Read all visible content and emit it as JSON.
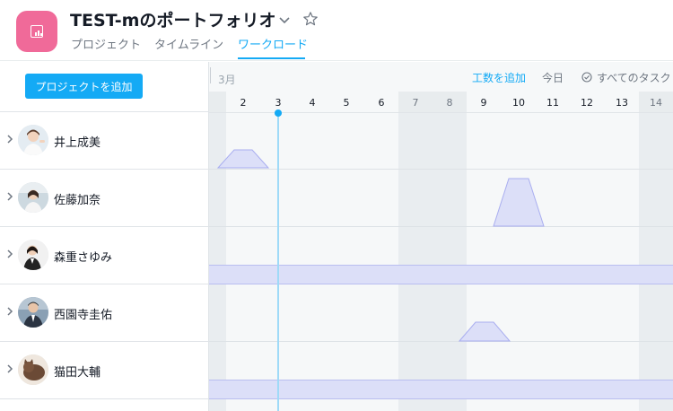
{
  "header": {
    "title": "TEST-mのポートフォリオ",
    "tabs": [
      {
        "label": "プロジェクト",
        "active": false
      },
      {
        "label": "タイムライン",
        "active": false
      },
      {
        "label": "ワークロード",
        "active": true
      }
    ],
    "app_icon": "chart-board-icon",
    "accent_color": "#14aaf5",
    "brand_color": "#f06a99"
  },
  "left": {
    "add_project_label": "プロジェクトを追加",
    "people": [
      {
        "name": "井上成美",
        "avatar": "avatar-woman-pointing"
      },
      {
        "name": "佐藤加奈",
        "avatar": "avatar-woman-office"
      },
      {
        "name": "森重さゆみ",
        "avatar": "avatar-woman-suit"
      },
      {
        "name": "西園寺圭佑",
        "avatar": "avatar-man-suit"
      },
      {
        "name": "猫田大輔",
        "avatar": "avatar-cat"
      }
    ]
  },
  "grid": {
    "month": "3月",
    "toolbar": {
      "add_effort": "工数を追加",
      "today": "今日",
      "all_tasks": "すべてのタスク"
    },
    "days": [
      {
        "label": "",
        "weekend": true
      },
      {
        "label": "2",
        "weekend": false
      },
      {
        "label": "3",
        "weekend": false
      },
      {
        "label": "4",
        "weekend": false
      },
      {
        "label": "5",
        "weekend": false
      },
      {
        "label": "6",
        "weekend": false
      },
      {
        "label": "7",
        "weekend": true
      },
      {
        "label": "8",
        "weekend": true
      },
      {
        "label": "9",
        "weekend": false
      },
      {
        "label": "10",
        "weekend": false
      },
      {
        "label": "11",
        "weekend": false
      },
      {
        "label": "12",
        "weekend": false
      },
      {
        "label": "13",
        "weekend": false
      },
      {
        "label": "14",
        "weekend": true
      }
    ],
    "today": "3",
    "load_color": "#dcdff8",
    "load_stroke": "#a9aef0"
  }
}
